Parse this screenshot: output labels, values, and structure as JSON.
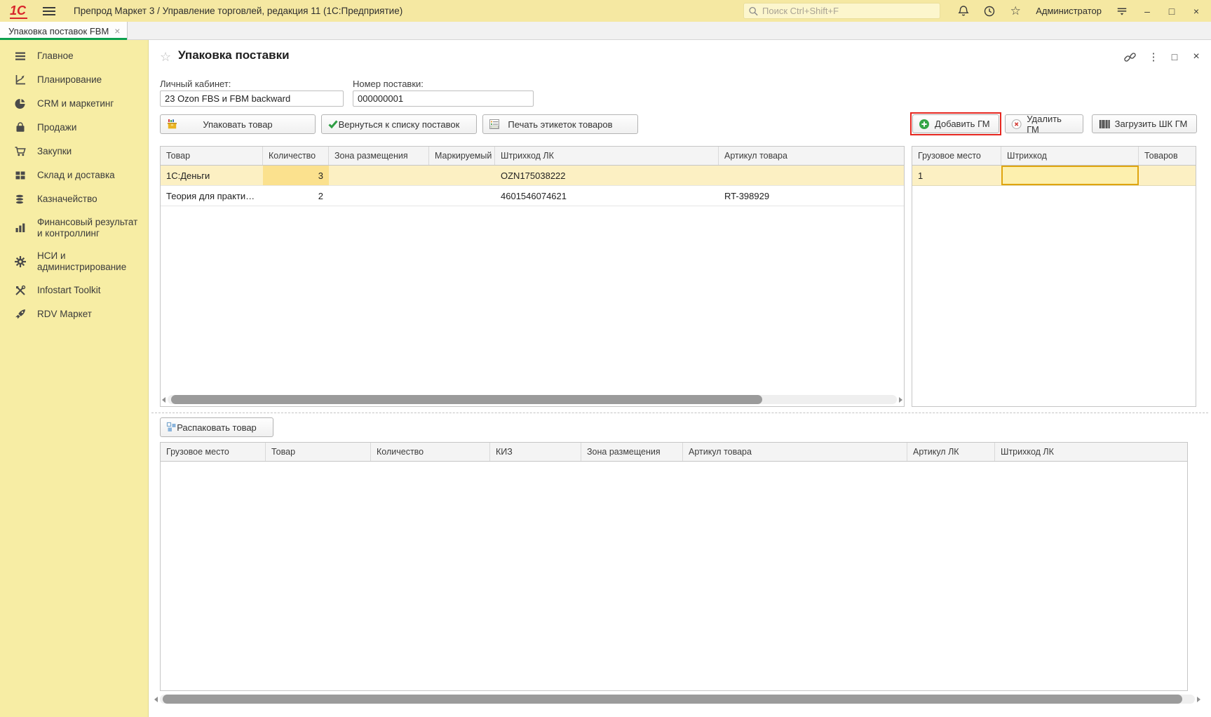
{
  "titlebar": {
    "logo": "1С",
    "title": "Препрод Маркет 3 / Управление торговлей, редакция 11  (1С:Предприятие)",
    "search_placeholder": "Поиск Ctrl+Shift+F",
    "user": "Администратор"
  },
  "icons": {
    "star_outline": "☆",
    "minimize": "–",
    "maximize": "□",
    "close": "×",
    "tab_close": "×",
    "more_dots": "⋮"
  },
  "tabbar": {
    "tabs": [
      {
        "label": "Упаковка поставок FBM"
      }
    ]
  },
  "sidebar": {
    "items": [
      {
        "label": "Главное"
      },
      {
        "label": "Планирование"
      },
      {
        "label": "CRM и маркетинг"
      },
      {
        "label": "Продажи"
      },
      {
        "label": "Закупки"
      },
      {
        "label": "Склад и доставка"
      },
      {
        "label": "Казначейство"
      },
      {
        "label": "Финансовый результат и контроллинг"
      },
      {
        "label": "НСИ и администрирование"
      },
      {
        "label": "Infostart Toolkit"
      },
      {
        "label": "RDV Маркет"
      }
    ]
  },
  "form": {
    "title": "Упаковка поставки",
    "cabinet_label": "Личный кабинет:",
    "cabinet_value": "23 Ozon FBS и FBM backward",
    "number_label": "Номер поставки:",
    "number_value": "000000001",
    "buttons": {
      "pack": "Упаковать товар",
      "back": "Вернуться к списку поставок",
      "print": "Печать этикеток товаров",
      "add_gm": "Добавить ГМ",
      "del_gm": "Удалить ГМ",
      "load_gm": "Загрузить ШК ГМ",
      "unpack": "Распаковать товар"
    }
  },
  "items_table": {
    "columns": [
      "Товар",
      "Количество",
      "Зона размещения",
      "Маркируемый",
      "Штрихкод ЛК",
      "Артикул товара"
    ],
    "rows": [
      {
        "tovar": "1С:Деньги",
        "qty": "3",
        "zone": "",
        "marked": "",
        "barcode_lk": "OZN175038222",
        "article": ""
      },
      {
        "tovar": "Теория для практи…",
        "qty": "2",
        "zone": "",
        "marked": "",
        "barcode_lk": "4601546074621",
        "article": "RT-398929"
      }
    ]
  },
  "cargo_table": {
    "columns": [
      "Грузовое место",
      "Штрихкод",
      "Товаров"
    ],
    "rows": [
      {
        "mesto": "1",
        "barcode": "",
        "tovarov": ""
      }
    ]
  },
  "packed_table": {
    "columns": [
      "Грузовое место",
      "Товар",
      "Количество",
      "КИЗ",
      "Зона размещения",
      "Артикул товара",
      "Артикул ЛК",
      "Штрихкод ЛК"
    ]
  },
  "colors": {
    "topbar": "#f5e8a2",
    "sidebar": "#f7eda4",
    "accent_green": "#0ca04e",
    "selection_yellow": "#fcf0c3",
    "active_cell_yellow": "#fbe18e",
    "edit_cell_border": "#dfa50f",
    "annotation_red": "#e5261f"
  }
}
